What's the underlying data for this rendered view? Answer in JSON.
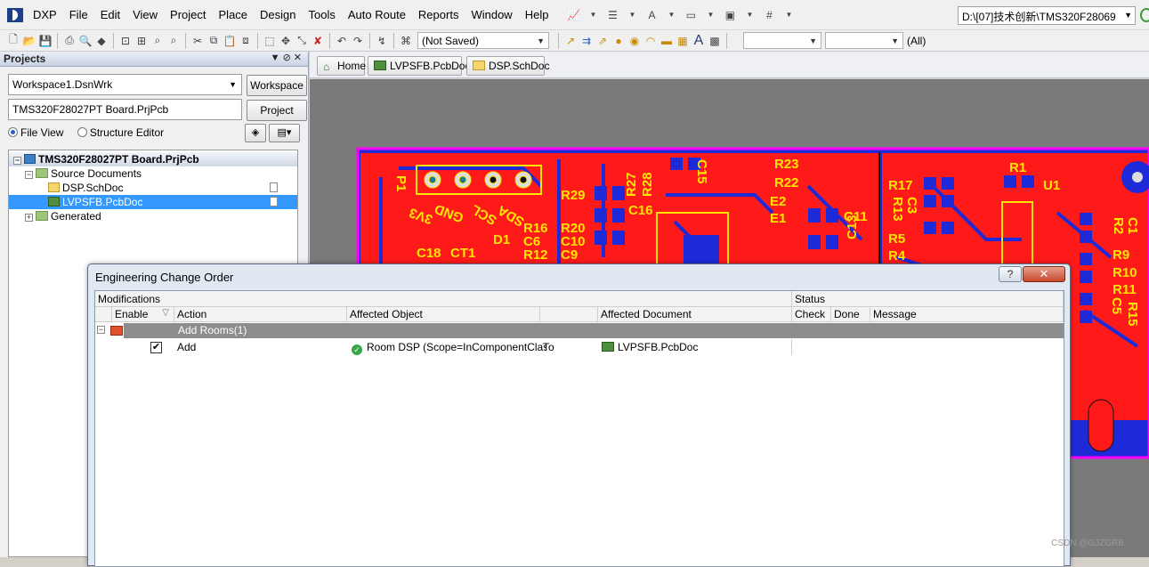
{
  "menubar": {
    "app": "DXP",
    "items": [
      "File",
      "Edit",
      "View",
      "Project",
      "Place",
      "Design",
      "Tools",
      "Auto Route",
      "Reports",
      "Window",
      "Help"
    ],
    "path": "D:\\[07]技术创新\\TMS320F28069"
  },
  "toolbar": {
    "saved_state": "(Not Saved)",
    "filter_all": "(All)"
  },
  "projects_panel": {
    "title": "Projects",
    "workspace_value": "Workspace1.DsnWrk",
    "workspace_button": "Workspace",
    "project_value": "TMS320F28027PT Board.PrjPcb",
    "project_button": "Project",
    "file_view": "File View",
    "structure_editor": "Structure Editor",
    "tree": {
      "root": "TMS320F28027PT Board.PrjPcb",
      "source_documents": "Source Documents",
      "doc1": "DSP.SchDoc",
      "doc2": "LVPSFB.PcbDoc",
      "generated": "Generated"
    }
  },
  "tabs": {
    "home": "Home",
    "pcb": "LVPSFB.PcbDoc",
    "sch": "DSP.SchDoc"
  },
  "pcb_canvas": {
    "colors": {
      "board": "#ff1a1a",
      "bottom": "#1e2ad8",
      "silk": "#ffe600",
      "outline": "#ff00ff"
    },
    "labels": {
      "p1": "P1",
      "v33": "3V3",
      "gnd": "GND",
      "scl": "SCL",
      "sda": "SDA",
      "d1": "D1",
      "c18": "C18",
      "ct1": "CT1",
      "r16": "R16",
      "c6": "C6",
      "r12": "R12",
      "r29": "R29",
      "r20": "R20",
      "c10": "C10",
      "c9": "C9",
      "r27": "R27",
      "r28": "R28",
      "c15": "C15",
      "c16": "C16",
      "r23": "R23",
      "r22": "R22",
      "e2": "E2",
      "e1": "E1",
      "c11": "C11",
      "c13": "C13",
      "r17": "R17",
      "r13": "R13",
      "c3": "C3",
      "r5": "R5",
      "r4": "R4",
      "r1": "R1",
      "u1": "U1",
      "r2": "R2",
      "c1": "C1",
      "r9": "R9",
      "r10": "R10",
      "r11": "R11",
      "c5": "C5",
      "r15": "R15"
    }
  },
  "eco_dialog": {
    "title": "Engineering Change Order",
    "help": "?",
    "close": "✕",
    "group_modifications": "Modifications",
    "group_status": "Status",
    "columns": {
      "enable": "Enable",
      "action": "Action",
      "affected_object": "Affected Object",
      "affected_document": "Affected Document",
      "check": "Check",
      "done": "Done",
      "message": "Message"
    },
    "group_row": "Add Rooms(1)",
    "row": {
      "checked": "✔",
      "action": "Add",
      "object": "Room DSP (Scope=InComponentClass('D",
      "to": "To",
      "document": "LVPSFB.PcbDoc"
    }
  },
  "watermark": "CSDN @GJZGRB"
}
